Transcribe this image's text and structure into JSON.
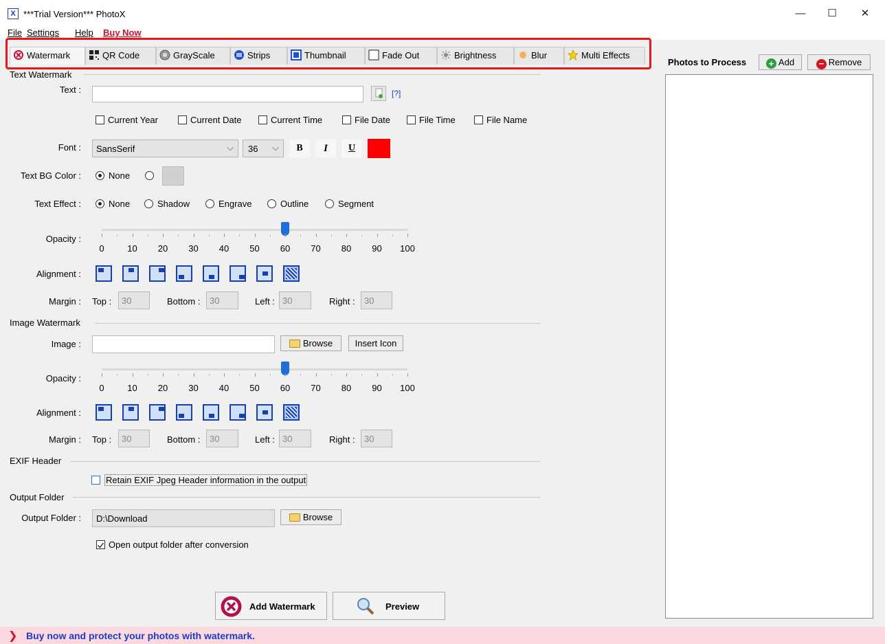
{
  "window": {
    "title": "***Trial Version*** PhotoX",
    "minimize": "—",
    "maximize": "☐",
    "close": "✕"
  },
  "menu": {
    "file": "File",
    "settings": "Settings",
    "help": "Help",
    "buy_now": "Buy Now"
  },
  "tabs": [
    {
      "label": "Watermark",
      "icon": "watermark-icon"
    },
    {
      "label": "QR Code",
      "icon": "qr-code-icon"
    },
    {
      "label": "GrayScale",
      "icon": "grayscale-icon"
    },
    {
      "label": "Strips",
      "icon": "strips-icon"
    },
    {
      "label": "Thumbnail",
      "icon": "thumbnail-icon"
    },
    {
      "label": "Fade Out",
      "icon": "fade-out-icon"
    },
    {
      "label": "Brightness",
      "icon": "brightness-icon"
    },
    {
      "label": "Blur",
      "icon": "blur-icon"
    },
    {
      "label": "Multi Effects",
      "icon": "star-icon"
    }
  ],
  "text_watermark": {
    "section": "Text Watermark",
    "text_label": "Text :",
    "text_value": "",
    "help_link": "[?]",
    "insert_options": [
      "Current Year",
      "Current Date",
      "Current Time",
      "File Date",
      "File Time",
      "File Name"
    ],
    "font_label": "Font :",
    "font_value": "SansSerif",
    "font_size": "36",
    "bold": "B",
    "italic": "I",
    "underline": "U",
    "text_color": "#ff0000",
    "bg_label": "Text BG Color :",
    "bg_none": "None",
    "effect_label": "Text Effect :",
    "effects": [
      "None",
      "Shadow",
      "Engrave",
      "Outline",
      "Segment"
    ],
    "opacity_label": "Opacity :",
    "opacity_value": 60,
    "ticks": [
      "0",
      "10",
      "20",
      "30",
      "40",
      "50",
      "60",
      "70",
      "80",
      "90",
      "100"
    ],
    "alignment_label": "Alignment :",
    "margin_label": "Margin :",
    "top_label": "Top :",
    "top_value": "30",
    "bottom_label": "Bottom :",
    "bottom_value": "30",
    "left_label": "Left :",
    "left_value": "30",
    "right_label": "Right :",
    "right_value": "30"
  },
  "image_watermark": {
    "section": "Image Watermark",
    "image_label": "Image :",
    "image_value": "",
    "browse": "Browse",
    "insert_icon": "Insert Icon",
    "opacity_label": "Opacity :",
    "opacity_value": 60,
    "ticks": [
      "0",
      "10",
      "20",
      "30",
      "40",
      "50",
      "60",
      "70",
      "80",
      "90",
      "100"
    ],
    "alignment_label": "Alignment :",
    "margin_label": "Margin :",
    "top_label": "Top :",
    "top_value": "30",
    "bottom_label": "Bottom :",
    "bottom_value": "30",
    "left_label": "Left :",
    "left_value": "30",
    "right_label": "Right :",
    "right_value": "30"
  },
  "exif": {
    "section": "EXIF Header",
    "retain": "Retain EXIF Jpeg Header information in the output"
  },
  "output": {
    "section": "Output Folder",
    "label": "Output Folder :",
    "value": "D:\\Download",
    "browse": "Browse",
    "open_after": "Open output folder after conversion"
  },
  "actions": {
    "add_watermark": "Add Watermark",
    "preview": "Preview"
  },
  "photos": {
    "title": "Photos to Process",
    "add": "Add",
    "remove": "Remove"
  },
  "footer": {
    "message": "Buy now and protect your photos with watermark."
  }
}
